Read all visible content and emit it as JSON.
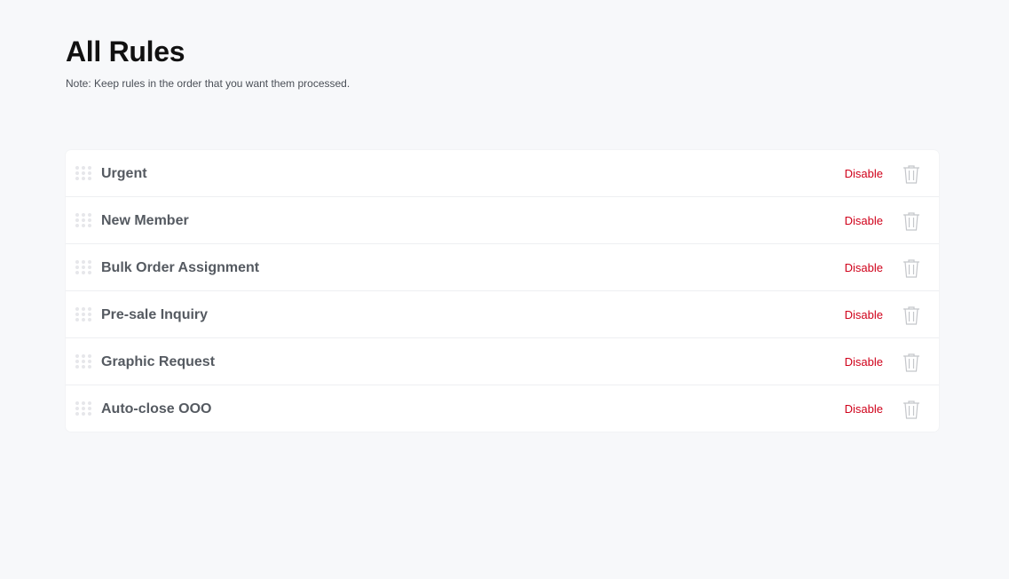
{
  "header": {
    "title": "All Rules",
    "note": "Note: Keep rules in the order that you want them processed."
  },
  "colors": {
    "background": "#f7f8fa",
    "disable_link": "#d0021b",
    "rule_text": "#555a61"
  },
  "rules": [
    {
      "name": "Urgent",
      "action_label": "Disable",
      "drag_icon": "drag-handle-icon",
      "delete_icon": "trash-icon"
    },
    {
      "name": "New Member",
      "action_label": "Disable",
      "drag_icon": "drag-handle-icon",
      "delete_icon": "trash-icon"
    },
    {
      "name": "Bulk Order Assignment",
      "action_label": "Disable",
      "drag_icon": "drag-handle-icon",
      "delete_icon": "trash-icon"
    },
    {
      "name": "Pre-sale Inquiry",
      "action_label": "Disable",
      "drag_icon": "drag-handle-icon",
      "delete_icon": "trash-icon"
    },
    {
      "name": "Graphic Request",
      "action_label": "Disable",
      "drag_icon": "drag-handle-icon",
      "delete_icon": "trash-icon"
    },
    {
      "name": "Auto-close OOO",
      "action_label": "Disable",
      "drag_icon": "drag-handle-icon",
      "delete_icon": "trash-icon"
    }
  ]
}
